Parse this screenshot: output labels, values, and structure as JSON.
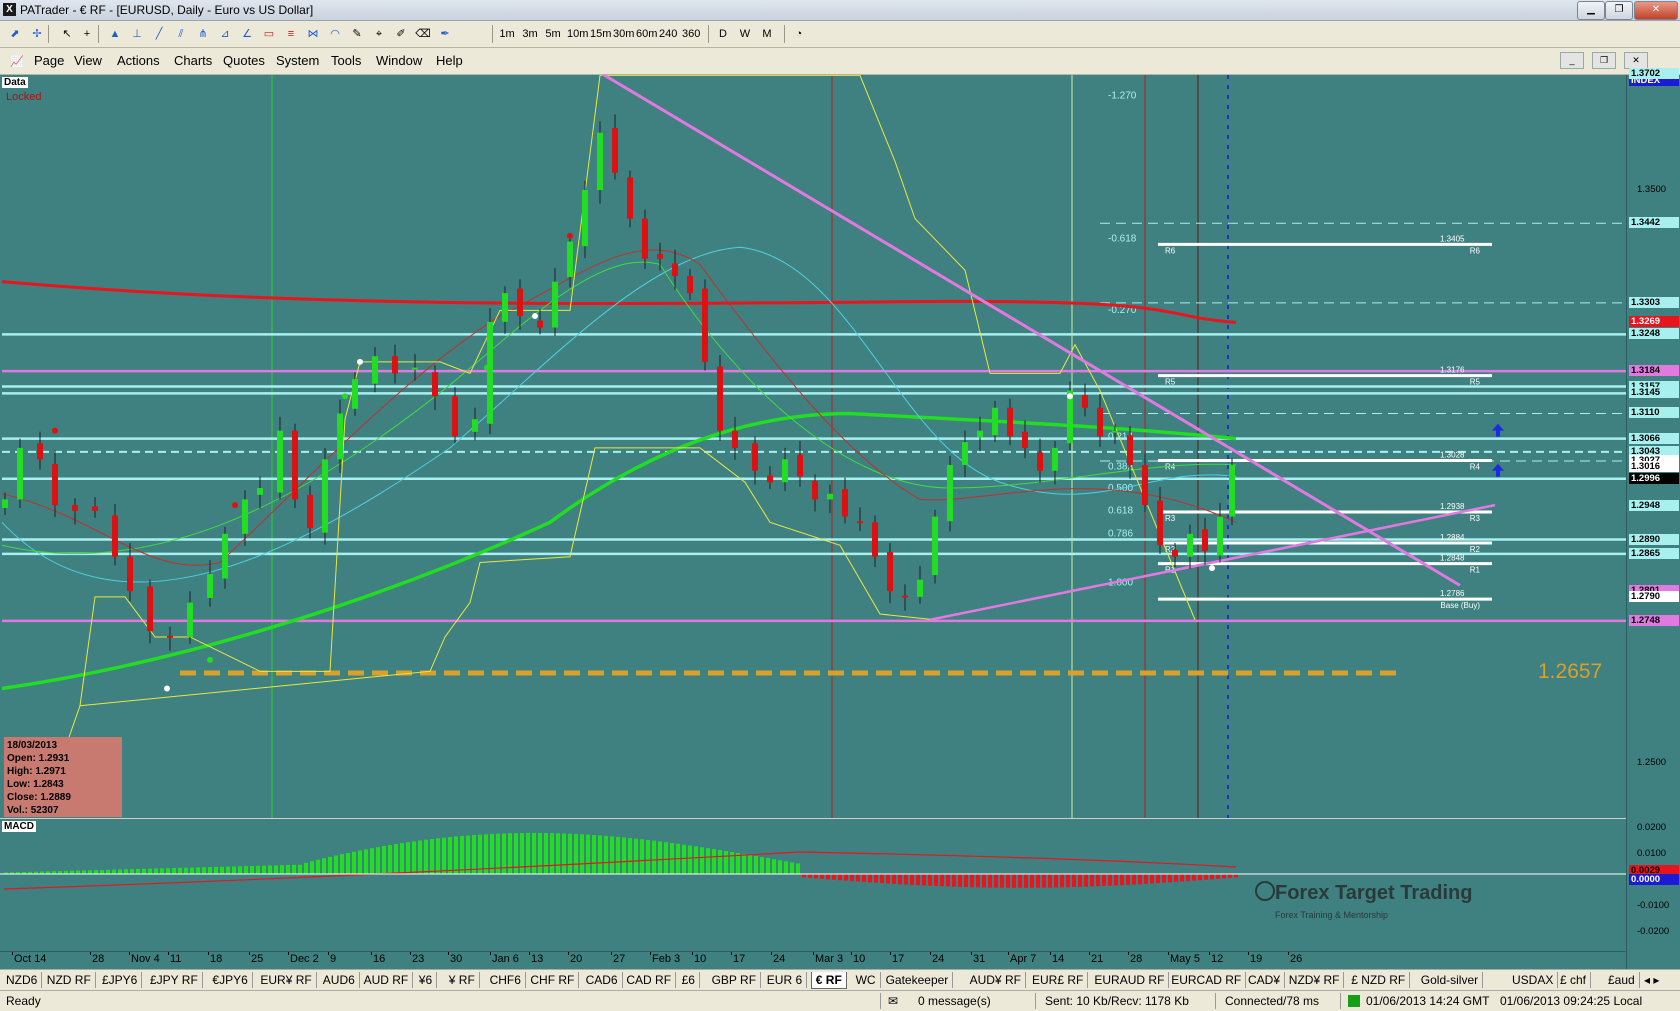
{
  "window": {
    "title": "PATrader - € RF - [EURUSD, Daily - Euro vs US Dollar]",
    "app_icon": "X",
    "buttons": [
      "minimize-icon",
      "restore-icon",
      "close-icon"
    ]
  },
  "toolbar": {
    "timeframes": [
      "1m",
      "3m",
      "5m",
      "10m",
      "15m",
      "30m",
      "60m",
      "240",
      "360"
    ],
    "periods": [
      "D",
      "W",
      "M"
    ],
    "tools": [
      "cursor-icon",
      "crosshair-icon",
      "fib-icon",
      "trendline-icon",
      "channel-icon",
      "pitchfork-icon",
      "rectangle-icon",
      "gann-icon",
      "text-icon",
      "clock-icon"
    ]
  },
  "menu": {
    "items": [
      "Page",
      "View",
      "Actions",
      "Charts",
      "Quotes",
      "System",
      "Tools",
      "Window",
      "Help"
    ]
  },
  "chart": {
    "data_label": "Data",
    "locked_label": "Locked",
    "index_label": "INDEX",
    "ohlc": {
      "date": "18/03/2013",
      "open": "Open: 1.2931",
      "high": "High: 1.2971",
      "low": "Low: 1.2843",
      "close": "Close: 1.2889",
      "vol": "Vol.: 52307"
    },
    "fib_levels": [
      "-1.270",
      "-0.618",
      "-0.270",
      "0.214",
      "0.382",
      "0.500",
      "0.618",
      "0.786",
      "1.000"
    ],
    "pivots": [
      {
        "label": "R6",
        "value": "1.3405"
      },
      {
        "label": "R5",
        "value": "1.3176"
      },
      {
        "label": "R4",
        "value": "1.3028"
      },
      {
        "label": "R3",
        "value": "1.2938"
      },
      {
        "label": "R2",
        "value": "1.2884"
      },
      {
        "label": "R1",
        "value": "1.2848"
      },
      {
        "label": "Base (Buy)",
        "value": "1.2786"
      }
    ],
    "big_price": "1.2657",
    "watermark": "Forex Target Trading",
    "watermark_sub": "Forex Training & Mentorship",
    "price_axis": [
      "1.3702",
      "1.3500",
      "1.3442",
      "1.3303",
      "1.3269",
      "1.3248",
      "1.3184",
      "1.3157",
      "1.3145",
      "1.3110",
      "1.3066",
      "1.3043",
      "1.3027",
      "1.3016",
      "1.2996",
      "1.2948",
      "1.2890",
      "1.2865",
      "1.2801",
      "1.2790",
      "1.2748",
      "1.2500"
    ],
    "x_axis": [
      "Oct 14",
      "28",
      "Nov 4",
      "11",
      "18",
      "25",
      "Dec 2",
      "9",
      "16",
      "23",
      "30",
      "Jan 6",
      "13",
      "20",
      "27",
      "Feb 3",
      "10",
      "17",
      "24",
      "Mar 3",
      "10",
      "17",
      "24",
      "31",
      "Apr 7",
      "14",
      "21",
      "28",
      "May 5",
      "12",
      "19",
      "26"
    ]
  },
  "macd": {
    "label": "MACD",
    "axis": [
      "0.0200",
      "0.0100",
      "0.0029",
      "0.0000",
      "-0.0100",
      "-0.0200"
    ]
  },
  "tabs": [
    "NZD6",
    "NZD RF",
    "£JPY6",
    "£JPY RF",
    "€JPY6",
    "EUR¥ RF",
    "AUD6",
    "AUD RF",
    "¥6",
    "¥ RF",
    "CHF6",
    "CHF RF",
    "CAD6",
    "CAD RF",
    "£6",
    "GBP RF",
    "EUR 6",
    "€ RF",
    "WC",
    "Gatekeeper",
    "AUD¥ RF",
    "EUR£ RF",
    "EURAUD RF",
    "EURCAD RF",
    "CAD¥",
    "NZD¥ RF",
    "£ NZD RF",
    "Gold-silver",
    "USDAX",
    "£ chf",
    "£aud"
  ],
  "active_tab": "€ RF",
  "status": {
    "ready": "Ready",
    "messages": "0 message(s)",
    "traffic": "Sent: 10 Kb/Recv: 1178 Kb",
    "connection": "Connected/78 ms",
    "gmt": "01/06/2013 14:24 GMT",
    "local": "01/06/2013 09:24:25 Local"
  },
  "colors": {
    "chart_bg": "#3f8080",
    "bull": "#22dd22",
    "bear": "#dd1111",
    "trend": "#e07ae0",
    "level": "#a8f0f0"
  }
}
